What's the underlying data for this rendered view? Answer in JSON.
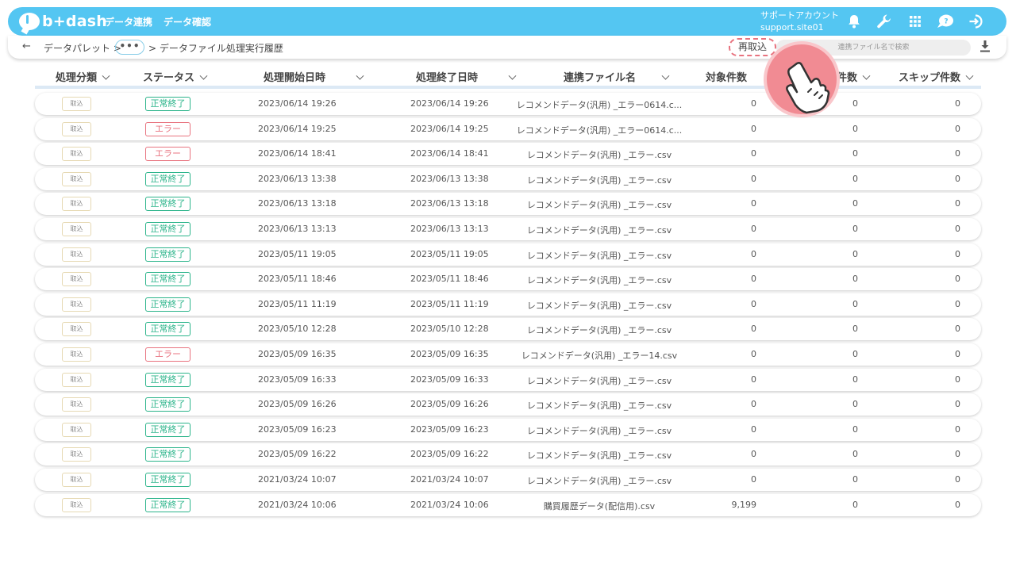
{
  "app": {
    "logo_text": "b+dash",
    "nav": [
      "データ連携",
      "データ確認"
    ],
    "account_name": "サポートアカウント",
    "account_id": "support.site01",
    "accent_color": "#54c6f2"
  },
  "icons": [
    "bell-icon",
    "wrench-icon",
    "grid-icon",
    "chat-icon",
    "logout-icon",
    "download-icon",
    "back-arrow-icon",
    "hand-pointer-icon"
  ],
  "breadcrumb": {
    "back": "←",
    "item1": "データパレット >",
    "more": "•••",
    "current": "> データファイル処理実行履歴"
  },
  "toolbar": {
    "reimport_label": "再取込",
    "search_placeholder": "連携ファイル名で検索"
  },
  "table": {
    "columns": [
      "処理分類",
      "ステータス",
      "処理開始日時",
      "処理終了日時",
      "連携ファイル名",
      "対象件数",
      "件数",
      "スキップ件数"
    ],
    "rows": [
      {
        "type": "取込",
        "status": "正常終了",
        "error": false,
        "start": "2023/06/14 19:26",
        "end": "2023/06/14 19:26",
        "file": "レコメンドデータ(汎用) _エラー0614.c...",
        "target": "0",
        "count": "0",
        "skip": "0"
      },
      {
        "type": "取込",
        "status": "エラー",
        "error": true,
        "start": "2023/06/14 19:25",
        "end": "2023/06/14 19:25",
        "file": "レコメンドデータ(汎用) _エラー0614.c...",
        "target": "0",
        "count": "0",
        "skip": "0"
      },
      {
        "type": "取込",
        "status": "エラー",
        "error": true,
        "start": "2023/06/14 18:41",
        "end": "2023/06/14 18:41",
        "file": "レコメンドデータ(汎用) _エラー.csv",
        "target": "0",
        "count": "0",
        "skip": "0"
      },
      {
        "type": "取込",
        "status": "正常終了",
        "error": false,
        "start": "2023/06/13 13:38",
        "end": "2023/06/13 13:38",
        "file": "レコメンドデータ(汎用) _エラー.csv",
        "target": "0",
        "count": "0",
        "skip": "0"
      },
      {
        "type": "取込",
        "status": "正常終了",
        "error": false,
        "start": "2023/06/13 13:18",
        "end": "2023/06/13 13:18",
        "file": "レコメンドデータ(汎用) _エラー.csv",
        "target": "0",
        "count": "0",
        "skip": "0"
      },
      {
        "type": "取込",
        "status": "正常終了",
        "error": false,
        "start": "2023/06/13 13:13",
        "end": "2023/06/13 13:13",
        "file": "レコメンドデータ(汎用) _エラー.csv",
        "target": "0",
        "count": "0",
        "skip": "0"
      },
      {
        "type": "取込",
        "status": "正常終了",
        "error": false,
        "start": "2023/05/11 19:05",
        "end": "2023/05/11 19:05",
        "file": "レコメンドデータ(汎用) _エラー.csv",
        "target": "0",
        "count": "0",
        "skip": "0"
      },
      {
        "type": "取込",
        "status": "正常終了",
        "error": false,
        "start": "2023/05/11 18:46",
        "end": "2023/05/11 18:46",
        "file": "レコメンドデータ(汎用) _エラー.csv",
        "target": "0",
        "count": "0",
        "skip": "0"
      },
      {
        "type": "取込",
        "status": "正常終了",
        "error": false,
        "start": "2023/05/11 11:19",
        "end": "2023/05/11 11:19",
        "file": "レコメンドデータ(汎用) _エラー.csv",
        "target": "0",
        "count": "0",
        "skip": "0"
      },
      {
        "type": "取込",
        "status": "正常終了",
        "error": false,
        "start": "2023/05/10 12:28",
        "end": "2023/05/10 12:28",
        "file": "レコメンドデータ(汎用) _エラー.csv",
        "target": "0",
        "count": "0",
        "skip": "0"
      },
      {
        "type": "取込",
        "status": "エラー",
        "error": true,
        "start": "2023/05/09 16:35",
        "end": "2023/05/09 16:35",
        "file": "レコメンドデータ(汎用) _エラー14.csv",
        "target": "0",
        "count": "0",
        "skip": "0"
      },
      {
        "type": "取込",
        "status": "正常終了",
        "error": false,
        "start": "2023/05/09 16:33",
        "end": "2023/05/09 16:33",
        "file": "レコメンドデータ(汎用) _エラー.csv",
        "target": "0",
        "count": "0",
        "skip": "0"
      },
      {
        "type": "取込",
        "status": "正常終了",
        "error": false,
        "start": "2023/05/09 16:26",
        "end": "2023/05/09 16:26",
        "file": "レコメンドデータ(汎用) _エラー.csv",
        "target": "0",
        "count": "0",
        "skip": "0"
      },
      {
        "type": "取込",
        "status": "正常終了",
        "error": false,
        "start": "2023/05/09 16:23",
        "end": "2023/05/09 16:23",
        "file": "レコメンドデータ(汎用) _エラー.csv",
        "target": "0",
        "count": "0",
        "skip": "0"
      },
      {
        "type": "取込",
        "status": "正常終了",
        "error": false,
        "start": "2023/05/09 16:22",
        "end": "2023/05/09 16:22",
        "file": "レコメンドデータ(汎用) _エラー.csv",
        "target": "0",
        "count": "0",
        "skip": "0"
      },
      {
        "type": "取込",
        "status": "正常終了",
        "error": false,
        "start": "2021/03/24 10:07",
        "end": "2021/03/24 10:07",
        "file": "レコメンドデータ(汎用) _エラー.csv",
        "target": "0",
        "count": "0",
        "skip": "0"
      },
      {
        "type": "取込",
        "status": "正常終了",
        "error": false,
        "start": "2021/03/24 10:06",
        "end": "2021/03/24 10:06",
        "file": "購買履歴データ(配信用).csv",
        "target": "9,199",
        "count": "0",
        "skip": "0"
      }
    ]
  }
}
